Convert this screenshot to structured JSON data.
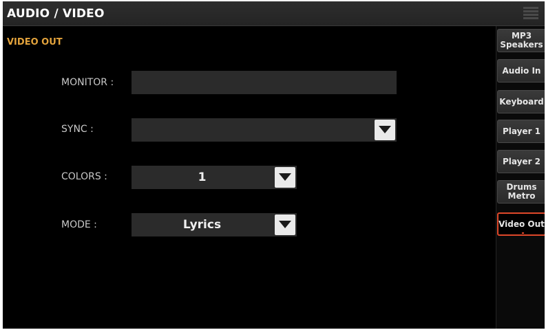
{
  "header": {
    "title": "AUDIO / VIDEO",
    "menu_icon": "hamburger-menu-icon"
  },
  "section": {
    "title": "VIDEO OUT"
  },
  "form": {
    "monitor": {
      "label": "MONITOR :",
      "value": ""
    },
    "sync": {
      "label": "SYNC :",
      "value": ""
    },
    "colors": {
      "label": "COLORS :",
      "value": "1"
    },
    "mode": {
      "label": "MODE :",
      "value": "Lyrics"
    }
  },
  "tabs": [
    {
      "label": "MP3 Speakers",
      "active": false
    },
    {
      "label": "Audio In",
      "active": false
    },
    {
      "label": "Keyboard",
      "active": false
    },
    {
      "label": "Player 1",
      "active": false
    },
    {
      "label": "Player 2",
      "active": false
    },
    {
      "label": "Drums Metro",
      "active": false
    },
    {
      "label": "Video Out",
      "active": true
    }
  ],
  "colors": {
    "section_title": "#e3a33c",
    "active_tab_border": "#e0482a",
    "background": "#000000",
    "field": "#2b2b2b"
  }
}
